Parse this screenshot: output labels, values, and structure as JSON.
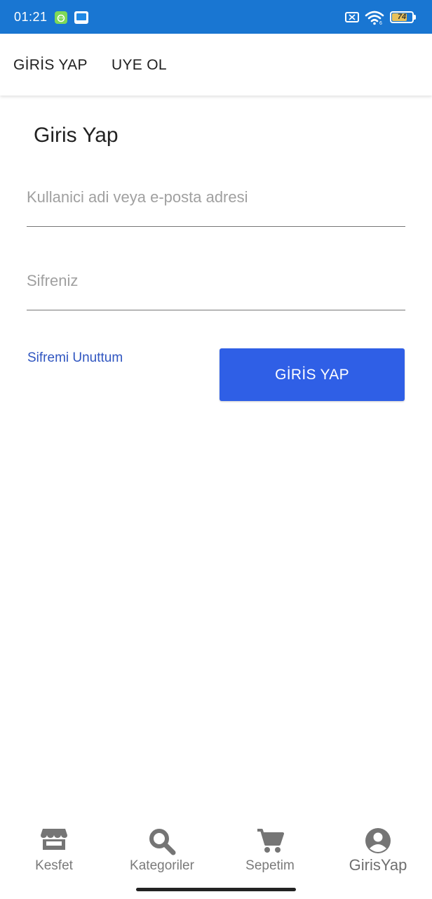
{
  "status_bar": {
    "time": "01:21",
    "battery_level": "74",
    "battery_fraction": 0.74
  },
  "tabs": [
    {
      "label": "GİRİS YAP"
    },
    {
      "label": "UYE OL"
    }
  ],
  "form": {
    "title": "Giris Yap",
    "username_placeholder": "Kullanici adi veya e-posta adresi",
    "username_value": "",
    "password_placeholder": "Sifreniz",
    "password_value": "",
    "forgot_label": "Sifremi Unuttum",
    "submit_label": "GİRİS YAP"
  },
  "bottom_nav": [
    {
      "label": "Kesfet",
      "icon": "store-icon"
    },
    {
      "label": "Kategoriler",
      "icon": "search-icon"
    },
    {
      "label": "Sepetim",
      "icon": "cart-icon"
    },
    {
      "label": "GirisYap",
      "icon": "account-circle-icon"
    }
  ],
  "colors": {
    "status_bar": "#1976d2",
    "primary_button": "#2f5fe6",
    "link": "#2f55c0",
    "nav_icon": "#757575"
  }
}
